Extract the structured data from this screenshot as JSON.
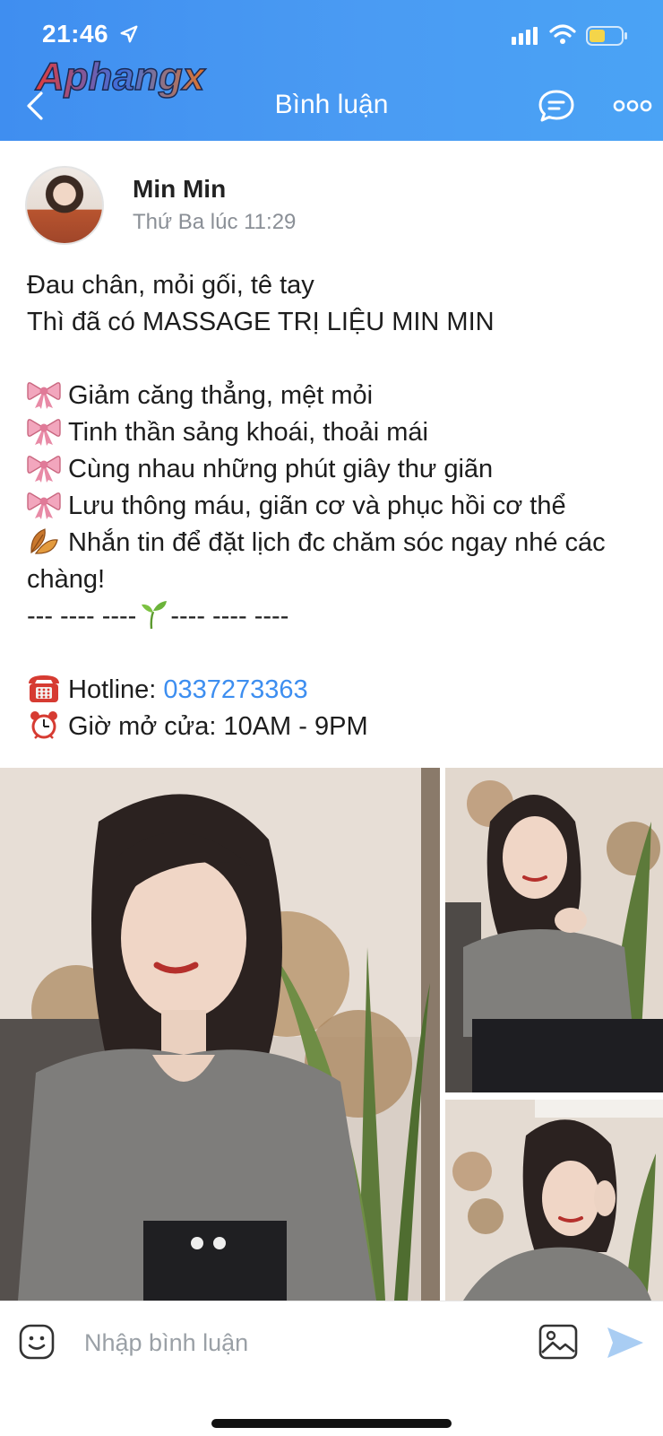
{
  "status_bar": {
    "time": "21:46"
  },
  "header": {
    "watermark": "Aphangx",
    "title": "Bình luận"
  },
  "post": {
    "author": "Min Min",
    "timestamp": "Thứ Ba lúc 11:29",
    "line1": "Đau chân, mỏi gối, tê tay",
    "line2": "Thì đã có MASSAGE TRỊ LIỆU MIN MIN",
    "bullets": [
      "Giảm căng thẳng, mệt mỏi",
      "Tinh thần sảng khoái, thoải mái",
      "Cùng nhau những phút giây thư giãn",
      "Lưu thông máu, giãn cơ và phục hồi cơ thể"
    ],
    "cta": "Nhắn tin để đặt lịch đc chăm sóc ngay nhé các chàng!",
    "divider_left": "--- ---- ----",
    "divider_right": "---- ---- ----",
    "hotline_label": "Hotline: ",
    "hotline_number": "0337273363",
    "hours": "Giờ mở cửa: 10AM - 9PM"
  },
  "composer": {
    "placeholder": "Nhập bình luận"
  },
  "icons": {
    "bullet": "ribbon-icon",
    "cta": "fallen-leaf-icon",
    "divider": "seedling-icon",
    "hotline": "telephone-icon",
    "hours": "alarm-clock-icon"
  },
  "colors": {
    "header": "#4a9bf3",
    "link": "#3d8ef0"
  }
}
